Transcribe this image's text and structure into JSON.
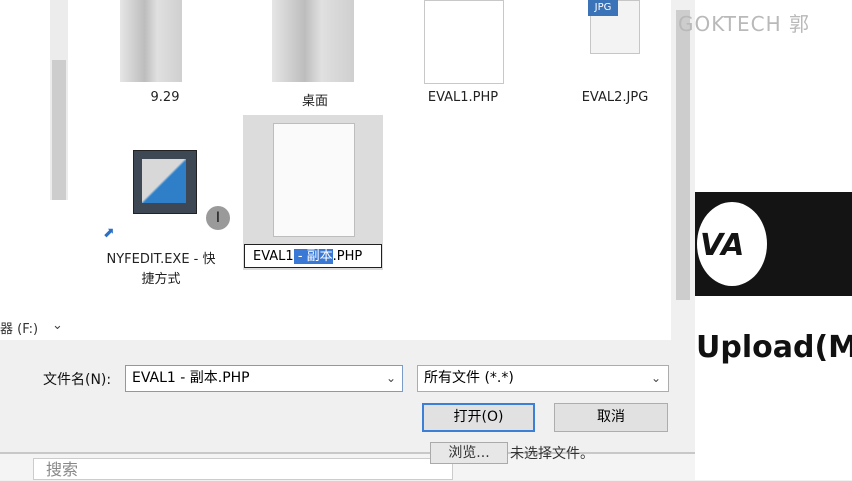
{
  "watermark": "GOKTECH 郭",
  "nav": {
    "drive_label": "器 (F:)",
    "chevron": "⌄"
  },
  "files": [
    {
      "name": "9.29"
    },
    {
      "name": "桌面"
    },
    {
      "name": "EVAL1.PHP"
    },
    {
      "name": "EVAL2.JPG",
      "badge": "JPG"
    },
    {
      "name_line1": "NYFEDIT.EXE - 快",
      "name_line2": "捷方式"
    }
  ],
  "rename": {
    "prefix": "EVAL1",
    "highlight": " - 副本",
    "suffix": ".PHP"
  },
  "cursor_glyph": "I",
  "filename": {
    "label": "文件名(N):",
    "value": "EVAL1 - 副本.PHP"
  },
  "filter": {
    "value": "所有文件 (*.*)"
  },
  "buttons": {
    "open": "打开(O)",
    "cancel": "取消"
  },
  "background_page": {
    "logo_text": "VA",
    "upload_heading": "Upload(M",
    "browse_label": "浏览...",
    "no_file_label": "未选择文件。",
    "search_placeholder": "搜索"
  },
  "colors": {
    "accent": "#3b7fd6",
    "selection": "#3a78d6"
  }
}
